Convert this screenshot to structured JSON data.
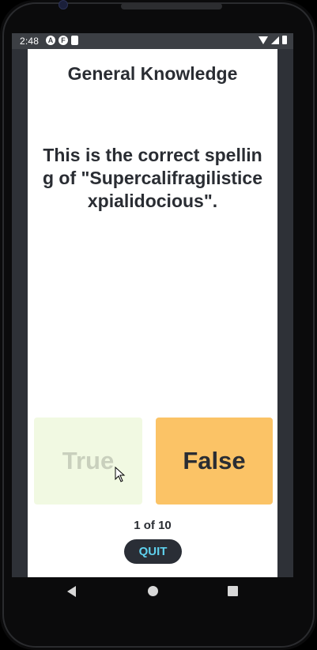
{
  "status_bar": {
    "time": "2:48",
    "left_icons": [
      "a-icon",
      "f-icon",
      "sd-card-icon"
    ],
    "right_icons": [
      "wifi-icon",
      "signal-icon",
      "battery-icon"
    ]
  },
  "quiz": {
    "category": "General Knowledge",
    "question": "This is the correct spelling of \"Supercalifragilisticexpialidocious\".",
    "answers": {
      "true_label": "True",
      "false_label": "False"
    },
    "progress": "1 of 10",
    "quit_label": "QUIT"
  },
  "nav_bar": {
    "buttons": [
      "back-icon",
      "home-icon",
      "recents-icon"
    ]
  },
  "colors": {
    "screen_background": "#2e3137",
    "card_background": "#ffffff",
    "true_button": "#f1f9e2",
    "false_button": "#fbc366",
    "quit_button": "#2a2e36",
    "quit_text": "#5fd1ee",
    "text": "#2a2d33"
  }
}
